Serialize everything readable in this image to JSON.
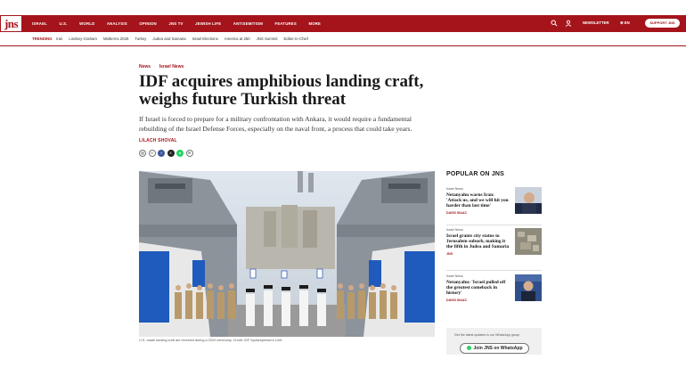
{
  "site": {
    "logo": "jns",
    "nav": [
      "ISRAEL",
      "U.S.",
      "WORLD",
      "ANALYSIS",
      "OPINION",
      "JNS TV",
      "JEWISH LIFE",
      "ANTISEMITISM",
      "FEATURES",
      "MORE"
    ],
    "newsletter": "NEWSLETTER",
    "language": "EN",
    "support": "SUPPORT JNS",
    "accent_color": "#a5141b"
  },
  "trending": {
    "label": "TRENDING",
    "items": [
      "Iran",
      "Lindsey Graham",
      "Midterms 2026",
      "Turkey",
      "Judea and Samaria",
      "Israel Elections",
      "America at 250",
      "JNS Summit",
      "Editor-in-Chief"
    ]
  },
  "article": {
    "breadcrumb": [
      "News",
      "Israel News"
    ],
    "headline": "IDF acquires amphibious landing craft, weighs future Turkish threat",
    "dek": "If Israel is forced to prepare for a military confrontation with Ankara, it would require a fundamental rebuilding of the Israel Defense Forces, especially on the naval front, a process that could take years.",
    "author": "LILACH SHOVAL",
    "caption": "U.S.-made landing craft are received during a 2024 ceremony. Credit: IDF Spokesperson's Unit."
  },
  "sidebar": {
    "title": "POPULAR ON JNS",
    "items": [
      {
        "category": "Israel News",
        "title": "Netanyahu warns Iran: 'Attack us, and we will hit you harder than last time'",
        "author": "DAVID ISAAC"
      },
      {
        "category": "Israel News",
        "title": "Israel grants city status to Jerusalem suburb, making it the fifth in Judea and Samaria",
        "author": "JNS"
      },
      {
        "category": "Israel News",
        "title": "Netanyahu: 'Israel pulled off the greatest comeback in history'",
        "author": "DAVID ISAAC"
      }
    ],
    "whatsapp_text": "Get the latest updates in our WhatsApp group",
    "whatsapp_button": "Join JNS on WhatsApp"
  }
}
